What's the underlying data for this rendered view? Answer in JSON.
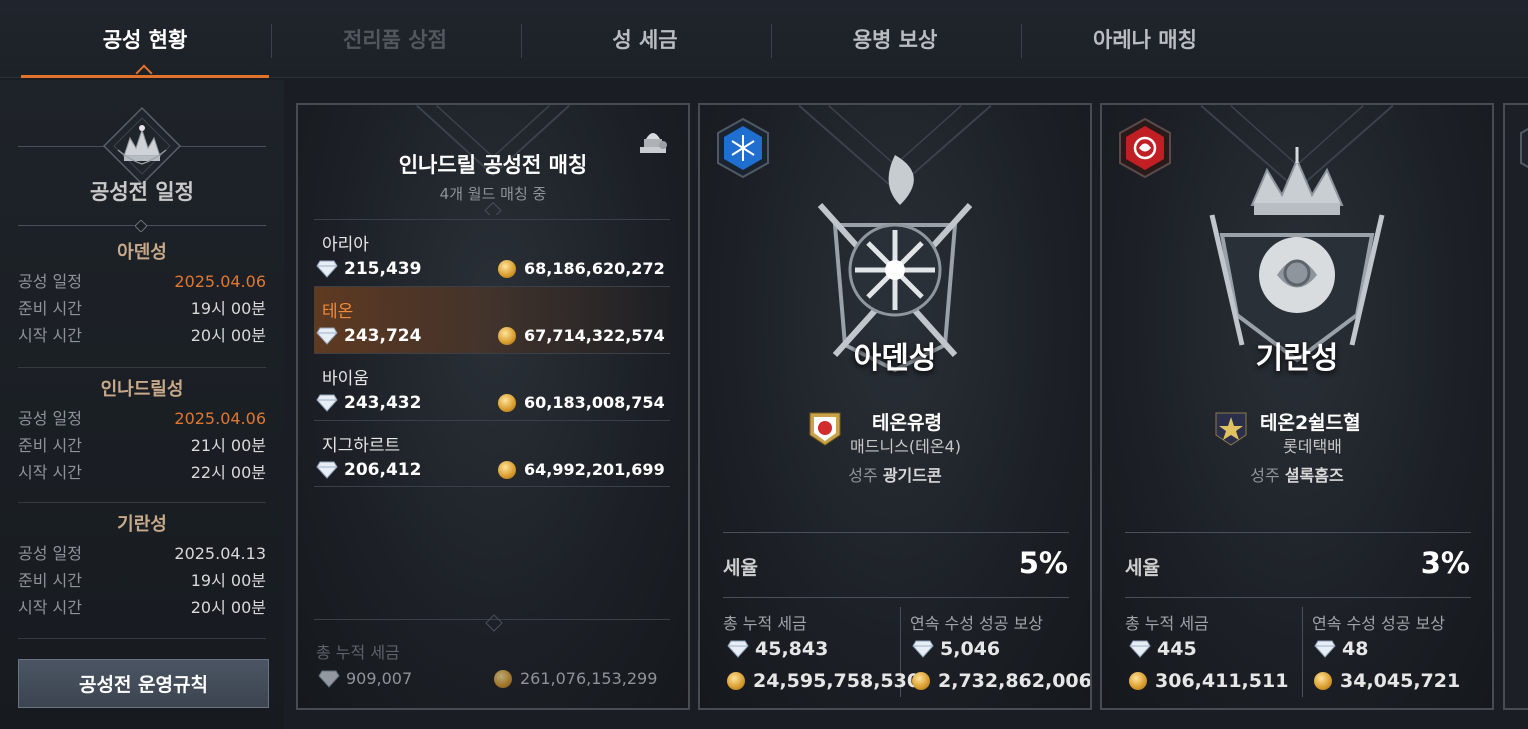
{
  "tabs": [
    {
      "label": "공성 현황",
      "state": "active"
    },
    {
      "label": "전리품 상점",
      "state": "disabled"
    },
    {
      "label": "성 세금",
      "state": "normal"
    },
    {
      "label": "용병 보상",
      "state": "normal"
    },
    {
      "label": "아레나 매칭",
      "state": "normal"
    }
  ],
  "schedule": {
    "title": "공성전 일정",
    "castles": [
      {
        "name": "아덴성",
        "date_label": "공성 일정",
        "date": "2025.04.06",
        "date_highlight": true,
        "prep_label": "준비 시간",
        "prep": "19시 00분",
        "start_label": "시작 시간",
        "start": "20시 00분"
      },
      {
        "name": "인나드릴성",
        "date_label": "공성 일정",
        "date": "2025.04.06",
        "date_highlight": true,
        "prep_label": "준비 시간",
        "prep": "21시 00분",
        "start_label": "시작 시간",
        "start": "22시 00분"
      },
      {
        "name": "기란성",
        "date_label": "공성 일정",
        "date": "2025.04.13",
        "date_highlight": false,
        "prep_label": "준비 시간",
        "prep": "19시 00분",
        "start_label": "시작 시간",
        "start": "20시 00분"
      }
    ],
    "rules_button": "공성전 운영규칙"
  },
  "matching": {
    "title": "인나드릴 공성전 매칭",
    "subtitle": "4개 월드 매칭 중",
    "worlds": [
      {
        "name": "아리아",
        "diamond": "215,439",
        "gold": "68,186,620,272",
        "selected": false
      },
      {
        "name": "테온",
        "diamond": "243,724",
        "gold": "67,714,322,574",
        "selected": true
      },
      {
        "name": "바이움",
        "diamond": "243,432",
        "gold": "60,183,008,754",
        "selected": false
      },
      {
        "name": "지그하르트",
        "diamond": "206,412",
        "gold": "64,992,201,699",
        "selected": false
      }
    ],
    "total_label": "총 누적 세금",
    "total_diamond": "909,007",
    "total_gold": "261,076,153,299"
  },
  "castle_cards": [
    {
      "castle": "아덴성",
      "badge_icon": "snowflake-badge-icon",
      "guild": "테온유령",
      "alliance": "매드니스(테온4)",
      "lord_label": "성주",
      "lord": "광기드콘",
      "tax_label": "세율",
      "tax": "5%",
      "total_label": "총 누적 세금",
      "total_diamond": "45,843",
      "total_gold": "24,595,758,530",
      "streak_label": "연속 수성 성공 보상",
      "streak_diamond": "5,046",
      "streak_gold": "2,732,862,006"
    },
    {
      "castle": "기란성",
      "badge_icon": "rose-badge-icon",
      "guild": "테온2쉴드혈",
      "alliance": "롯데택배",
      "lord_label": "성주",
      "lord": "셜록홈즈",
      "tax_label": "세율",
      "tax": "3%",
      "total_label": "총 누적 세금",
      "total_diamond": "445",
      "total_gold": "306,411,511",
      "streak_label": "연속 수성 성공 보상",
      "streak_diamond": "48",
      "streak_gold": "34,045,721"
    }
  ],
  "colors": {
    "accent": "#e0722c",
    "highlight_text": "#e0772f",
    "panel_bg": "#1c2026",
    "border": "#474c53"
  }
}
